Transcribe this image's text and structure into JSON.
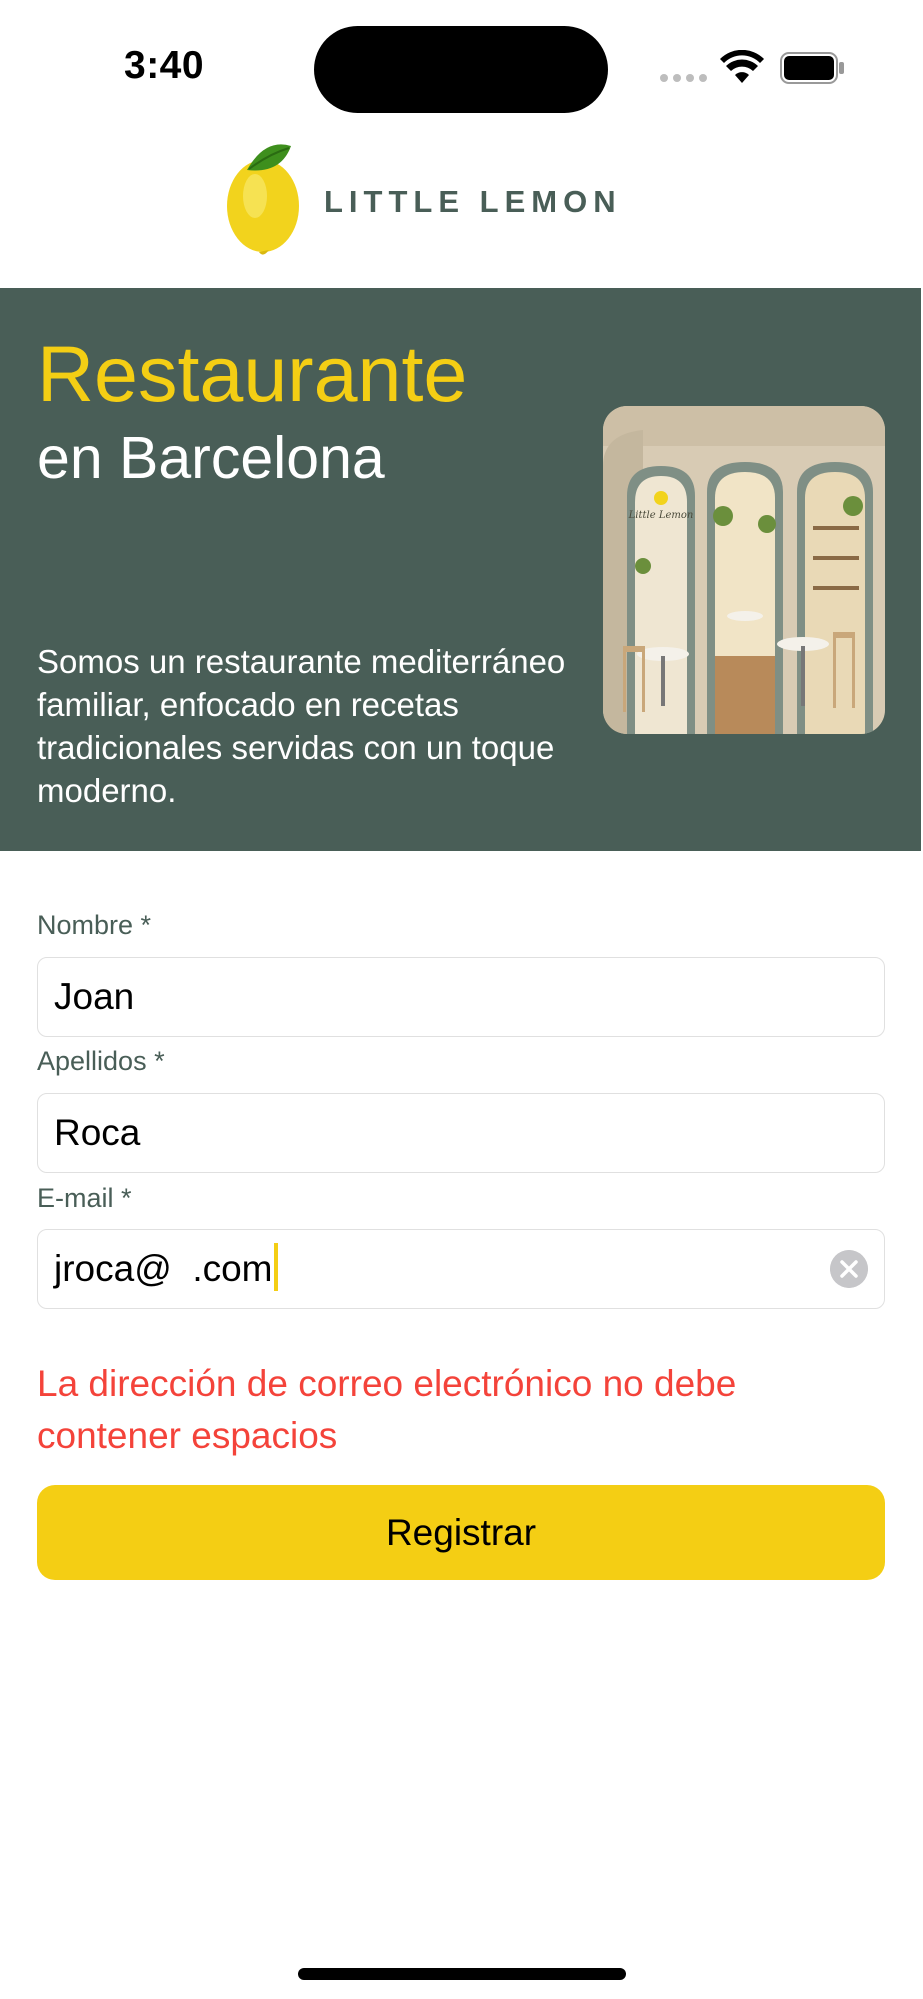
{
  "status_bar": {
    "time": "3:40"
  },
  "header": {
    "brand": "LITTLE LEMON"
  },
  "hero": {
    "title": "Restaurante",
    "subtitle": "en Barcelona",
    "description": "Somos un restaurante mediterráneo familiar, enfocado en recetas tradicionales servidas con un toque moderno.",
    "image_sign": "Little Lemon"
  },
  "form": {
    "first_name": {
      "label": "Nombre *",
      "value": "Joan"
    },
    "last_name": {
      "label": "Apellidos *",
      "value": "Roca"
    },
    "email": {
      "label": "E-mail *",
      "value": "jroca@  .com"
    },
    "error": "La dirección de correo electrónico no debe contener espacios",
    "submit_label": "Registrar"
  },
  "colors": {
    "primary_green": "#495e57",
    "primary_yellow": "#f4ce14",
    "error_red": "#f4433a"
  },
  "icons": [
    "lemon-logo-icon",
    "wifi-icon",
    "battery-icon",
    "signal-icon",
    "clear-icon"
  ]
}
